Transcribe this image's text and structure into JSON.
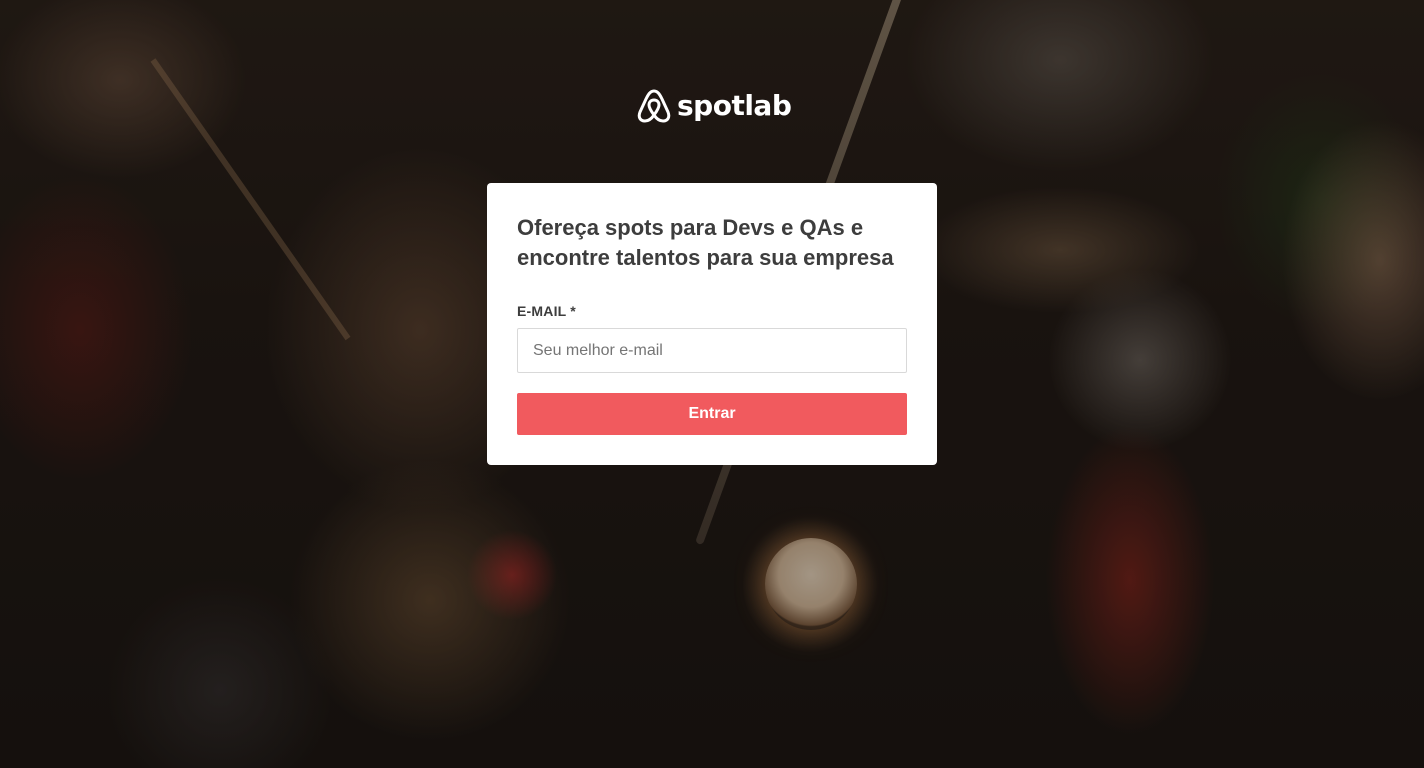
{
  "brand": {
    "name": "spotlab",
    "logo_icon": "airbnb-belo-icon",
    "accent_color": "#f15a5e"
  },
  "card": {
    "title": "Ofereça spots para Devs e QAs e encontre talentos para sua empresa",
    "email_label": "E-MAIL *",
    "email_placeholder": "Seu melhor e-mail",
    "email_value": "",
    "submit_label": "Entrar"
  }
}
